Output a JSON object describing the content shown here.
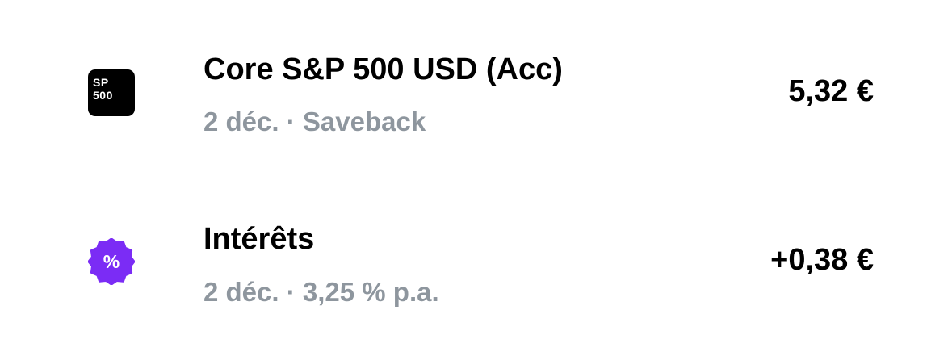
{
  "transactions": [
    {
      "icon": "sp500-logo-icon",
      "logo_line1": "SP",
      "logo_line2": "500",
      "title": "Core S&P 500 USD (Acc)",
      "subtitle": "2 déc. · Saveback",
      "amount": "5,32 €"
    },
    {
      "icon": "percent-badge-icon",
      "badge_symbol": "%",
      "title": "Intérêts",
      "subtitle": "2 déc. · 3,25 % p.a.",
      "amount": "+0,38 €"
    }
  ],
  "colors": {
    "logo_bg": "#000000",
    "badge_bg": "#7b2cf5",
    "subtitle": "#8e969e",
    "text": "#000000"
  }
}
